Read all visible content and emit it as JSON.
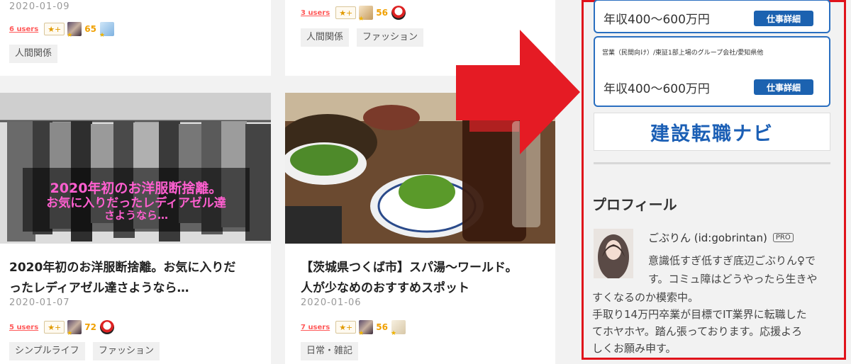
{
  "top_left": {
    "date": "2020-01-09",
    "users": "6 users",
    "star": "★+",
    "count": "65",
    "tag": "人間関係"
  },
  "top_right": {
    "users": "3 users",
    "star": "★+",
    "count": "56",
    "tags": [
      "人間関係",
      "ファッション"
    ]
  },
  "card_left": {
    "overlay": [
      "2020年初のお洋服断捨離。",
      "お気に入りだったレディアゼル達",
      "さようなら…"
    ],
    "title_lines": [
      "2020年初のお洋服断捨離。お気に入りだ",
      "ったレディアゼル達さようなら…"
    ],
    "date": "2020-01-07",
    "users": "5 users",
    "star": "★+",
    "count": "72",
    "tags": [
      "シンプルライフ",
      "ファッション"
    ]
  },
  "card_right": {
    "title_lines": [
      "【茨城県つくば市】スパ湯〜ワールド。",
      "人が少なめのおすすめスポット"
    ],
    "date": "2020-01-06",
    "users": "7 users",
    "star": "★+",
    "count": "56",
    "tags": [
      "日常・雑記"
    ]
  },
  "sidebar": {
    "job1": {
      "salary": "年収400〜600万円",
      "button": "仕事詳細"
    },
    "job2": {
      "heading": "営業（民間向け）/東証1部上場のグループ会社/愛知県他",
      "salary": "年収400〜600万円",
      "button": "仕事詳細"
    },
    "ad_banner": "建設転職ナビ",
    "profile": {
      "heading": "プロフィール",
      "name": "ごぶりん (id:gobrintan)",
      "badge": "PRO",
      "bio_lines": [
        "意識低すぎ低すぎ底辺ごぶりん♀で",
        "す。コミュ障はどうやったら生きや",
        "すくなるのか模索中。",
        "手取り14万円卒業が目標でIT業界に転職した",
        "てホヤホヤ。踏ん張っております。応援よろ",
        "しくお願み申す。"
      ]
    }
  },
  "colors": {
    "highlight": "#e0131b",
    "job_blue": "#1c62b0",
    "users_red": "#ff5a5a"
  }
}
